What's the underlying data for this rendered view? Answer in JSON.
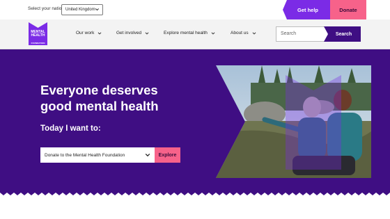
{
  "utility": {
    "nation_label": "Select your nation",
    "nation_value": "United Kingdom",
    "get_help": "Get help",
    "donate": "Donate"
  },
  "logo": {
    "line1": "MENTAL",
    "line2": "HEALTH",
    "line3": "FOUNDATION"
  },
  "nav": {
    "items": [
      {
        "label": "Our work"
      },
      {
        "label": "Get involved"
      },
      {
        "label": "Explore mental health"
      },
      {
        "label": "About us"
      }
    ],
    "search_placeholder": "Search",
    "search_button": "Search"
  },
  "hero": {
    "title_line1": "Everyone deserves",
    "title_line2": "good mental health",
    "subtitle": "Today I want to:",
    "select_value": "Donate to the Mental Health Foundation",
    "explore_button": "Explore"
  },
  "colors": {
    "brand_purple": "#3f0e83",
    "accent_purple": "#7b2be6",
    "accent_pink": "#f7628a"
  },
  "icons": [
    "chevron-down-icon",
    "mental-health-foundation-logo"
  ]
}
